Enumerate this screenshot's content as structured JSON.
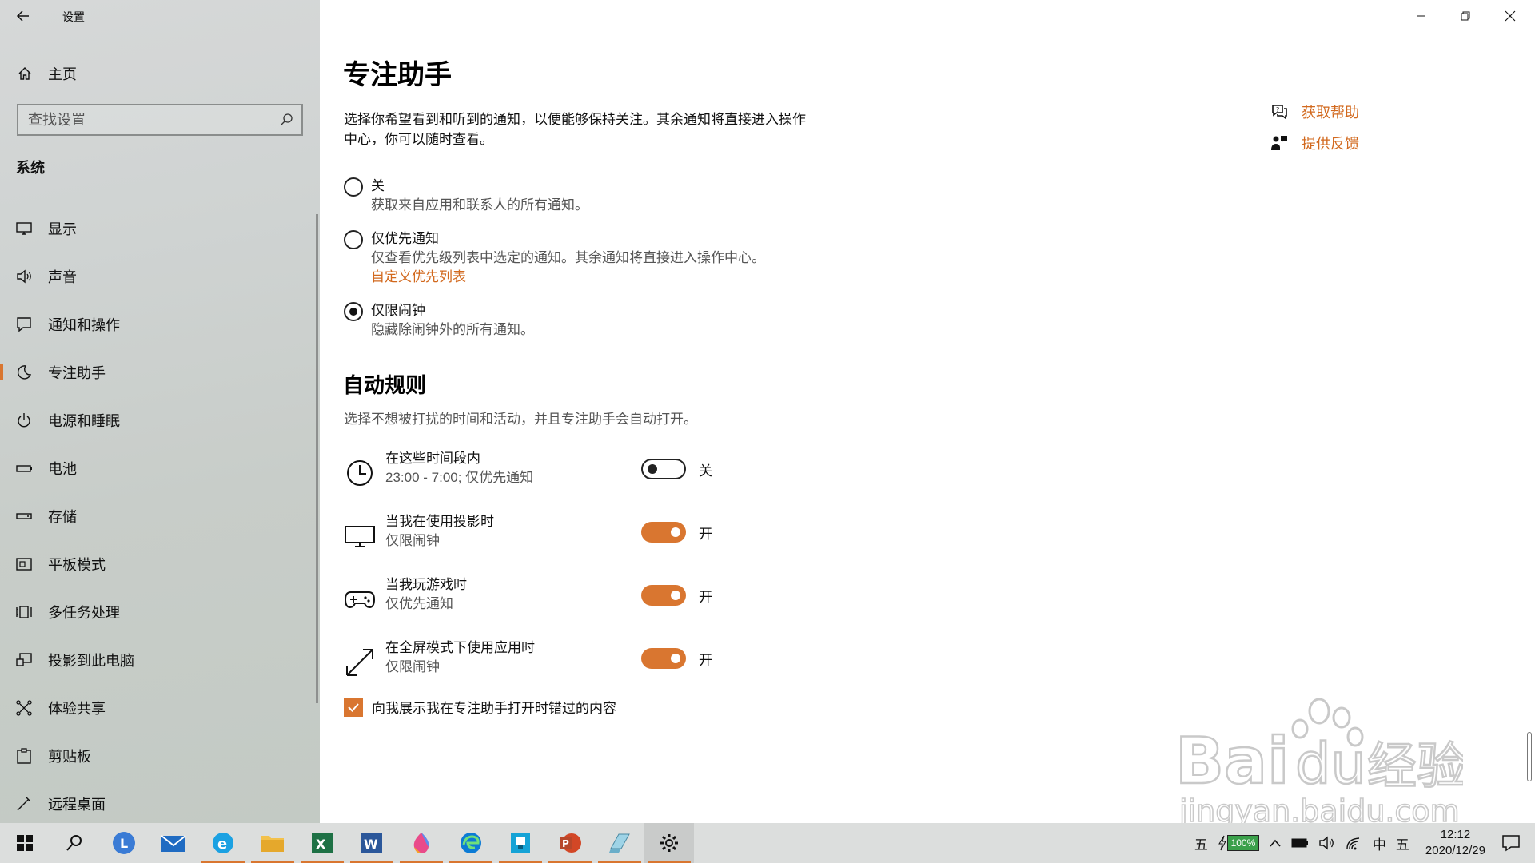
{
  "window": {
    "app_title": "设置"
  },
  "sidebar": {
    "home_label": "主页",
    "search_placeholder": "查找设置",
    "section_title": "系统",
    "items": [
      {
        "label": "显示",
        "icon": "monitor-icon"
      },
      {
        "label": "声音",
        "icon": "speaker-icon"
      },
      {
        "label": "通知和操作",
        "icon": "notification-icon"
      },
      {
        "label": "专注助手",
        "icon": "moon-icon",
        "active": true
      },
      {
        "label": "电源和睡眠",
        "icon": "power-icon"
      },
      {
        "label": "电池",
        "icon": "battery-icon"
      },
      {
        "label": "存储",
        "icon": "storage-icon"
      },
      {
        "label": "平板模式",
        "icon": "tablet-icon"
      },
      {
        "label": "多任务处理",
        "icon": "multitask-icon"
      },
      {
        "label": "投影到此电脑",
        "icon": "project-icon"
      },
      {
        "label": "体验共享",
        "icon": "share-icon"
      },
      {
        "label": "剪贴板",
        "icon": "clipboard-icon"
      },
      {
        "label": "远程桌面",
        "icon": "remote-desktop-icon"
      }
    ]
  },
  "main": {
    "title": "专注助手",
    "intro": "选择你希望看到和听到的通知，以便能够保持关注。其余通知将直接进入操作中心，你可以随时查看。",
    "options": [
      {
        "title": "关",
        "desc": "获取来自应用和联系人的所有通知。",
        "checked": false
      },
      {
        "title": "仅优先通知",
        "desc": "仅查看优先级列表中选定的通知。其余通知将直接进入操作中心。",
        "link": "自定义优先列表",
        "checked": false
      },
      {
        "title": "仅限闹钟",
        "desc": "隐藏除闹钟外的所有通知。",
        "checked": true
      }
    ],
    "auto_rules_title": "自动规则",
    "auto_rules_desc": "选择不想被打扰的时间和活动，并且专注助手会自动打开。",
    "rules": [
      {
        "title": "在这些时间段内",
        "sub": "23:00 - 7:00; 仅优先通知",
        "state": "关",
        "on": false,
        "icon": "clock-icon"
      },
      {
        "title": "当我在使用投影时",
        "sub": "仅限闹钟",
        "state": "开",
        "on": true,
        "icon": "monitor-icon"
      },
      {
        "title": "当我玩游戏时",
        "sub": "仅优先通知",
        "state": "开",
        "on": true,
        "icon": "gamepad-icon"
      },
      {
        "title": "在全屏模式下使用应用时",
        "sub": "仅限闹钟",
        "state": "开",
        "on": true,
        "icon": "fullscreen-icon"
      }
    ],
    "checkbox_label": "向我展示我在专注助手打开时错过的内容",
    "checkbox_checked": true,
    "help_links": [
      {
        "label": "获取帮助",
        "icon": "help-chat-icon"
      },
      {
        "label": "提供反馈",
        "icon": "feedback-icon"
      }
    ]
  },
  "taskbar": {
    "apps": [
      "start-icon",
      "search-icon",
      "lenovo-icon",
      "mail-icon",
      "ie-icon",
      "file-explorer-icon",
      "excel-icon",
      "word-icon",
      "colorful-app-icon",
      "edge-icon",
      "snip-icon",
      "powerpoint-icon",
      "notebook-icon",
      "settings-icon"
    ],
    "tray": {
      "ime_left": "五",
      "battery_percent": "100%",
      "lang": "中",
      "ime_right": "五",
      "time": "12:12",
      "date": "2020/12/29"
    }
  },
  "watermark": {
    "brand": "Baidu经验",
    "url": "jingyan.baidu.com"
  },
  "colors": {
    "accent": "#d97630",
    "link": "#d2691e"
  }
}
